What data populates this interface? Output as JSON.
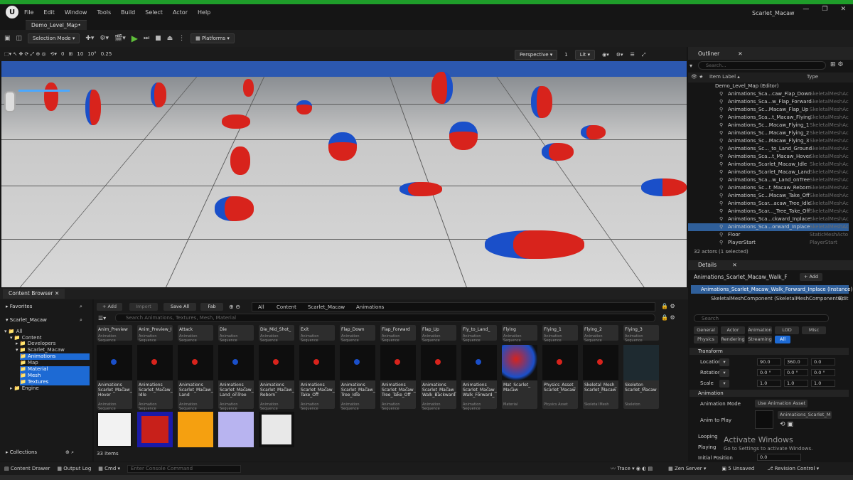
{
  "menu": [
    "File",
    "Edit",
    "Window",
    "Tools",
    "Build",
    "Select",
    "Actor",
    "Help"
  ],
  "window_title": "Scarlet_Macaw",
  "level_tab": "Demo_Level_Map•",
  "toolbar": {
    "selection_mode": "Selection Mode",
    "platforms": "Platforms"
  },
  "viewport_bar": {
    "rot": "0",
    "grid": "10",
    "angle": "10°",
    "scale": "0.25",
    "persp": "Perspective",
    "lit": "Lit",
    "count": "1"
  },
  "outliner": {
    "title": "Outliner",
    "search_placeholder": "Search...",
    "col_label": "Item Label ▴",
    "col_type": "Type",
    "root": "Demo_Level_Map (Editor)",
    "items": [
      {
        "label": "Animations_Sca...caw_Flap_Down",
        "type": "SkeletalMeshAc"
      },
      {
        "label": "Animations_Sca...w_Flap_Forward",
        "type": "SkeletalMeshAc"
      },
      {
        "label": "Animations_Sc...Macaw_Flap_Up",
        "type": "SkeletalMeshAc"
      },
      {
        "label": "Animations_Sca...t_Macaw_Flying",
        "type": "SkeletalMeshAc"
      },
      {
        "label": "Animations_Sc...Macaw_Flying_1",
        "type": "SkeletalMeshAc"
      },
      {
        "label": "Animations_Sc...Macaw_Flying_2",
        "type": "SkeletalMeshAc"
      },
      {
        "label": "Animations_Sc...Macaw_Flying_3",
        "type": "SkeletalMeshAc"
      },
      {
        "label": "Animations_Sc..._to_Land_Ground",
        "type": "SkeletalMeshAc"
      },
      {
        "label": "Animations_Sca...t_Macaw_Hover",
        "type": "SkeletalMeshAc"
      },
      {
        "label": "Animations_Scarlet_Macaw_Idle",
        "type": "SkeletalMeshAc"
      },
      {
        "label": "Animations_Scarlet_Macaw_Land",
        "type": "SkeletalMeshAc"
      },
      {
        "label": "Animations_Sca...w_Land_onTree",
        "type": "SkeletalMeshAc"
      },
      {
        "label": "Animations_Sc...t_Macaw_Reborn",
        "type": "SkeletalMeshAc"
      },
      {
        "label": "Animations_Sc...Macaw_Take_Off",
        "type": "SkeletalMeshAc"
      },
      {
        "label": "Animations_Scar...acaw_Tree_Idle",
        "type": "SkeletalMeshAc"
      },
      {
        "label": "Animations_Scar..._Tree_Take_Off",
        "type": "SkeletalMeshAc"
      },
      {
        "label": "Animations_Sca...ckward_Inplace",
        "type": "SkeletalMeshAc"
      },
      {
        "label": "Animations_Sca...orward_Inplace",
        "type": "SkeletalMeshAc"
      },
      {
        "label": "Floor",
        "type": "StaticMeshActo"
      },
      {
        "label": "PlayerStart",
        "type": "PlayerStart"
      }
    ],
    "footer": "32 actors (1 selected)"
  },
  "details": {
    "title": "Details",
    "actor_name": "Animations_Scarlet_Macaw_Walk_F",
    "add": "+ Add",
    "instance": "Animations_Scarlet_Macaw_Walk_Forward_Inplace (Instance)",
    "component": "SkeletalMeshComponent (SkeletalMeshComponent0)",
    "edit": "Edit",
    "search": "Search",
    "tabs_row1": [
      "General",
      "Actor",
      "Animation",
      "LOD",
      "Misc"
    ],
    "tabs_row2": [
      "Physics",
      "Rendering",
      "Streaming",
      "All"
    ],
    "transform": "Transform",
    "location": "Location",
    "rotation": "Rotation",
    "scale": "Scale",
    "loc_vals": [
      "90.0",
      "360.0",
      "0.0"
    ],
    "rot_vals": [
      "0.0 °",
      "0.0 °",
      "0.0 °"
    ],
    "scale_vals": [
      "1.0",
      "1.0",
      "1.0"
    ],
    "animation": "Animation",
    "anim_mode_label": "Animation Mode",
    "anim_mode": "Use Animation Asset",
    "anim_to_play": "Anim to Play",
    "anim_asset": "Animations_Scarlet_M",
    "looping": "Looping",
    "playing": "Playing",
    "initial_position": "Initial Position",
    "initial_value": "0.0"
  },
  "activate": {
    "line1": "Activate Windows",
    "line2": "Go to Settings to activate Windows."
  },
  "content_browser": {
    "tab": "Content Browser",
    "add": "+ Add",
    "import": "Import",
    "save_all": "Save All",
    "fab": "Fab",
    "path": [
      "All",
      "Content",
      "Scarlet_Macaw",
      "Animations"
    ],
    "favorites": "Favorites",
    "project": "Scarlet_Macaw",
    "search_placeholder": "Search Animations, Textures, Mesh, Material",
    "tree": [
      "All",
      "Content",
      "Developers",
      "Scarlet_Macaw",
      "Animations",
      "Map",
      "Material",
      "Mesh",
      "Textures",
      "Engine"
    ],
    "collections": "Collections",
    "count": "33 items",
    "row1": [
      "Anim_Preview",
      "Anim_Preview_I",
      "Attack",
      "Die",
      "Die_Mid_Shot_",
      "Exit",
      "Flap_Down",
      "Flap_Forward",
      "Flap_Up",
      "Fly_to_Land_",
      "Flying",
      "Flying_1",
      "Flying_2",
      "Flying_3"
    ],
    "row1_type": "Animation Sequence",
    "row2": [
      {
        "name": "Animations_ Scarlet_Macaw_ Hover",
        "type": "Animation Sequence"
      },
      {
        "name": "Animations_ Scarlet_Macaw_ Idle",
        "type": "Animation Sequence"
      },
      {
        "name": "Animations_ Scarlet_Macaw_ Land",
        "type": "Animation Sequence"
      },
      {
        "name": "Animations_ Scarlet_Macaw_ Land_onTree",
        "type": "Animation Sequence"
      },
      {
        "name": "Animations_ Scarlet_Macaw_ Reborn",
        "type": "Animation Sequence"
      },
      {
        "name": "Animations_ Scarlet_Macaw_ Take_Off",
        "type": "Animation Sequence"
      },
      {
        "name": "Animations_ Scarlet_Macaw_ Tree_Idle",
        "type": "Animation Sequence"
      },
      {
        "name": "Animations_ Scarlet_Macaw_ Tree_Take_Off",
        "type": "Animation Sequence"
      },
      {
        "name": "Animations_ Scarlet_Macaw_ Walk_Backward",
        "type": "Animation Sequence"
      },
      {
        "name": "Animations_ Scarlet_Macaw_ Walk_Forward_",
        "type": "Animation Sequence"
      },
      {
        "name": "Mat_Scarlet_ Macaw",
        "type": "Material"
      },
      {
        "name": "Physics_Asset_ Scarlet_Macaw",
        "type": "Physics Asset"
      },
      {
        "name": "Skeletal_Mesh_ Scarlet_Macaw",
        "type": "Skeletal Mesh"
      },
      {
        "name": "Skeleton_ Scarlet_Macaw",
        "type": "Skeleton"
      }
    ]
  },
  "status": {
    "drawer": "Content Drawer",
    "output": "Output Log",
    "cmd": "Cmd",
    "console": "Enter Console Command",
    "trace": "Trace",
    "zen": "Zen Server",
    "unsaved": "5 Unsaved",
    "revision": "Revision Control"
  },
  "colors": {
    "accent": "#1d6ad4",
    "selected": "#2f5f9a",
    "play": "#5fbf3a",
    "sky": "#2c58b0",
    "macaw": "#d8231c",
    "wing": "#1a4fc9"
  }
}
